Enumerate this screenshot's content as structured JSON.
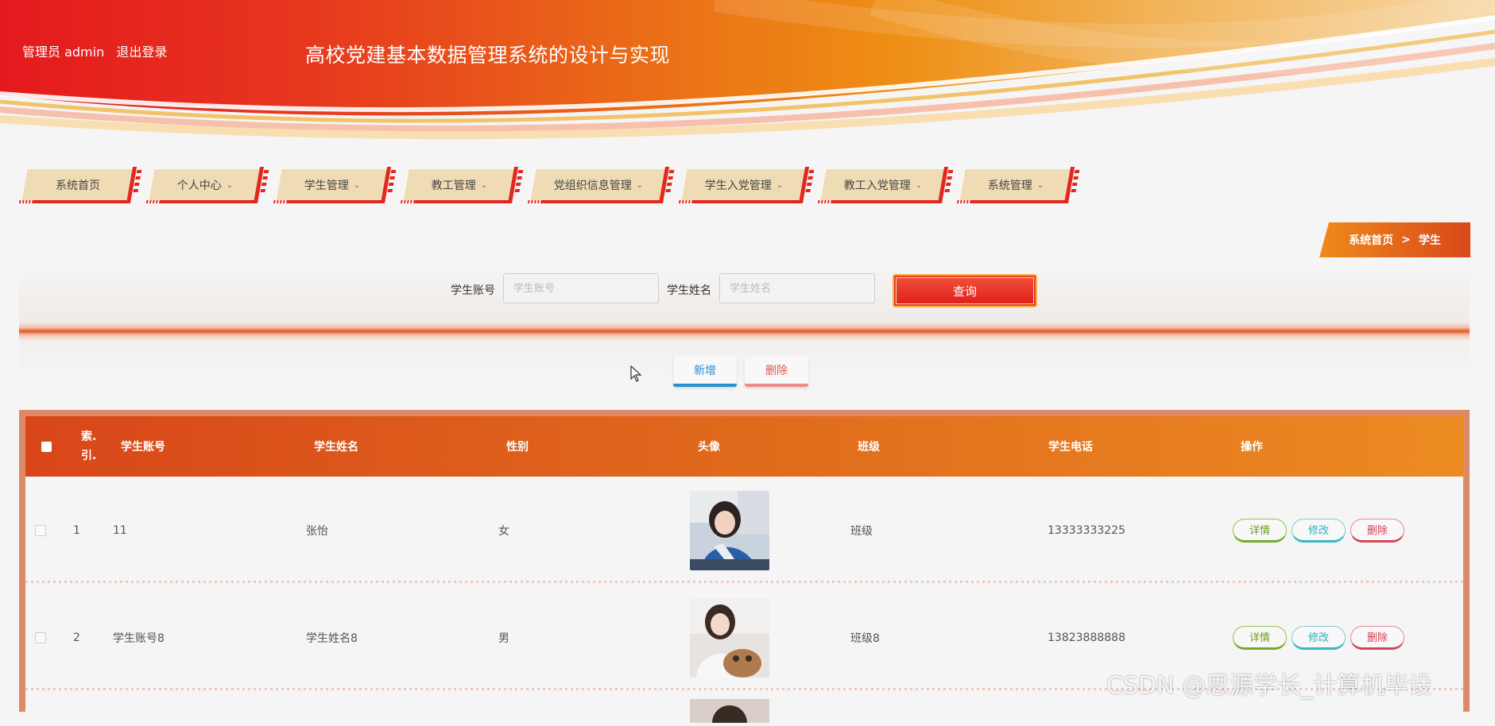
{
  "header": {
    "user_label": "管理员 admin",
    "logout_label": "退出登录",
    "site_title": "高校党建基本数据管理系统的设计与实现"
  },
  "nav": {
    "items": [
      {
        "label": "系统首页",
        "has_dropdown": false
      },
      {
        "label": "个人中心",
        "has_dropdown": true
      },
      {
        "label": "学生管理",
        "has_dropdown": true
      },
      {
        "label": "教工管理",
        "has_dropdown": true
      },
      {
        "label": "党组织信息管理",
        "has_dropdown": true
      },
      {
        "label": "学生入党管理",
        "has_dropdown": true
      },
      {
        "label": "教工入党管理",
        "has_dropdown": true
      },
      {
        "label": "系统管理",
        "has_dropdown": true
      }
    ],
    "chevron": "⌄"
  },
  "breadcrumb": {
    "home": "系统首页",
    "separator": ">",
    "current": "学生"
  },
  "search": {
    "account_label": "学生账号",
    "account_placeholder": "学生账号",
    "account_value": "",
    "name_label": "学生姓名",
    "name_placeholder": "学生姓名",
    "name_value": "",
    "query_label": "查询"
  },
  "actions": {
    "add_label": "新增",
    "delete_label": "删除"
  },
  "table": {
    "columns": {
      "index_line1": "索.",
      "index_line2": "引.",
      "account": "学生账号",
      "name": "学生姓名",
      "gender": "性别",
      "avatar": "头像",
      "class": "班级",
      "phone": "学生电话",
      "ops": "操作"
    },
    "rows": [
      {
        "index": "1",
        "account": "11",
        "name": "张怡",
        "gender": "女",
        "class": "班级",
        "phone": "13333333225"
      },
      {
        "index": "2",
        "account": "学生账号8",
        "name": "学生姓名8",
        "gender": "男",
        "class": "班级8",
        "phone": "13823888888"
      }
    ],
    "op_labels": {
      "detail": "详情",
      "edit": "修改",
      "delete": "删除"
    }
  },
  "watermark": "CSDN @思源学长_计算机毕设",
  "colors": {
    "brand_red": "#e2271e",
    "brand_orange": "#ec8b22",
    "nav_bg": "#f0dcb4",
    "detail_green": "#7aa82b",
    "edit_cyan": "#3ab8c2",
    "delete_red": "#d44458"
  }
}
